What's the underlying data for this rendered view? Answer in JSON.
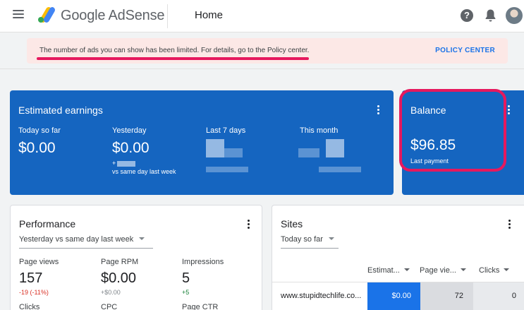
{
  "header": {
    "brand": "Google AdSense",
    "page_title": "Home"
  },
  "banner": {
    "message": "The number of ads you can show has been limited. For details, go to the Policy center.",
    "link_label": "POLICY CENTER"
  },
  "earnings": {
    "title": "Estimated earnings",
    "today": {
      "label": "Today so far",
      "value": "$0.00"
    },
    "yesterday": {
      "label": "Yesterday",
      "value": "$0.00",
      "change": "+",
      "compare": "vs same day last week"
    },
    "last7": {
      "label": "Last 7 days"
    },
    "month": {
      "label": "This month"
    }
  },
  "balance": {
    "title": "Balance",
    "value": "$96.85",
    "sub": "Last payment"
  },
  "performance": {
    "title": "Performance",
    "range": "Yesterday vs same day last week",
    "metrics": [
      {
        "label": "Page views",
        "value": "157",
        "change": "-19 (-11%)"
      },
      {
        "label": "Page RPM",
        "value": "$0.00",
        "change": "+$0.00"
      },
      {
        "label": "Impressions",
        "value": "5",
        "change": "+5"
      }
    ],
    "more_labels": [
      "Clicks",
      "CPC",
      "Page CTR"
    ]
  },
  "sites": {
    "title": "Sites",
    "range": "Today so far",
    "columns": [
      "Estimat...",
      "Page vie...",
      "Clicks"
    ],
    "rows": [
      {
        "site": "www.stupidtechlife.co...",
        "earnings": "$0.00",
        "page_views": "72",
        "clicks": "0"
      }
    ]
  },
  "colors": {
    "card_blue": "#1565c0",
    "highlight": "#e6195e",
    "banner_bg": "#fce8e6",
    "link": "#1a73e8"
  },
  "icons": [
    "menu-icon",
    "adsense-logo",
    "help-icon",
    "bell-icon",
    "more-vert-icon",
    "caret-down-icon"
  ]
}
